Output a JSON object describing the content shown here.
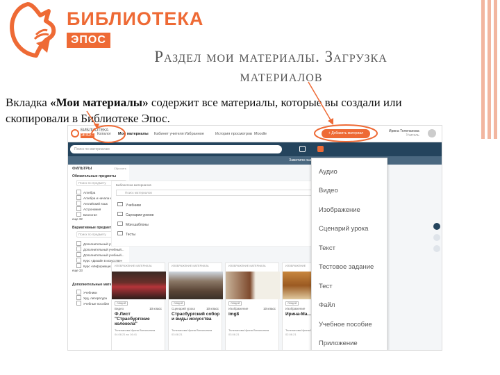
{
  "logo": {
    "title": "БИБЛИОТЕКА",
    "subtitle": "ЭПОС",
    "brand_color": "#ee6a35"
  },
  "slide": {
    "title_line1": "Раздел мои материалы. Загрузка",
    "title_line2": "материалов",
    "caption_pre": "Вкладка ",
    "caption_bold": "«Мои материалы»",
    "caption_post": " содержит все материалы, которые вы создали или скопировали в Библиотеке Эпос."
  },
  "app": {
    "logo_text1": "БИБЛИОТЕКА",
    "logo_text2": "ЭПОС",
    "nav": [
      "Каталог",
      "Мои материалы",
      "Кабинет учителя",
      "Избранное",
      "История просмотров",
      "Moodle"
    ],
    "add_button": "+ Добавить материал",
    "user_name": "Ирина Телепанова",
    "user_role": "Учитель",
    "search_placeholder": "Поиск по материалам",
    "notice": "Заметили ошибку? Выделите текст и нажмите Alt+Enter",
    "filters": {
      "title": "ФИЛЬТРЫ",
      "reset": "Сбросить",
      "search_placeholder": "Поиск по предмету",
      "required_title": "Обязательные предметы",
      "required_items": [
        "Алгебра",
        "Алгебра и начала матем.",
        "Английский язык",
        "Астрономия",
        "Биология"
      ],
      "more1": "еще 32",
      "optional_title": "Вариативные предметы",
      "optional_search": "Поиск по предмету",
      "optional_items": [
        "Дополнительный учебный...",
        "Дополнительный учебный...",
        "Дополнительный учебный...",
        "Курс «Дизайн в искусстве»",
        "Курс «Информационные бе...»"
      ],
      "more2": "еще 33",
      "extra_title": "Дополнительные материалы",
      "extra_items": [
        "Учебники",
        "Худ. литература",
        "Учебные пособия"
      ]
    },
    "library": {
      "title": "Библиотека материалов",
      "search_placeholder": "Поиск материалов",
      "folders": [
        "Учебники",
        "Сценарии уроков",
        "Мои шаблоны",
        "Тесты"
      ]
    },
    "cards": [
      {
        "head": "ИЗОБРАЖЕНИЕ МАТЕРИАЛА",
        "tag": "ОБЩИЙ",
        "type": "Видео",
        "grade": "10 класс",
        "name": "Ф.Лист \"Страсбургские колокола\"",
        "author": "Телепанова Ирина Витальевна",
        "date": "04.08.21  во 16:41"
      },
      {
        "head": "ИЗОБРАЖЕНИЕ МАТЕРИАЛА",
        "tag": "ОБЩИЙ",
        "type": "Сценарий урока",
        "grade": "10 класс",
        "name": "Страсбургский собор и виды искусства",
        "author": "Телепанова Ирина Витальевна",
        "date": "03.08.21"
      },
      {
        "head": "ИЗОБРАЖЕНИЕ МАТЕРИАЛА",
        "tag": "ОБЩИЙ",
        "type": "Изображение",
        "grade": "10 класс",
        "name": "img8",
        "author": "Телепанова Ирина Витальевна",
        "date": "03.08.21"
      },
      {
        "head": "ИЗОБРАЖЕНИЕ",
        "tag": "ОБЩИЙ",
        "type": "Изображение",
        "grade": "",
        "name": "Ирина-Ма...",
        "author": "Телепанова Ирина Витальевна",
        "date": "02.08.21"
      }
    ],
    "dropdown": [
      "Аудио",
      "Видео",
      "Изображение",
      "Сценарий урока",
      "Текст",
      "Тестовое задание",
      "Тест",
      "Файл",
      "Учебное пособие",
      "Приложение"
    ]
  }
}
